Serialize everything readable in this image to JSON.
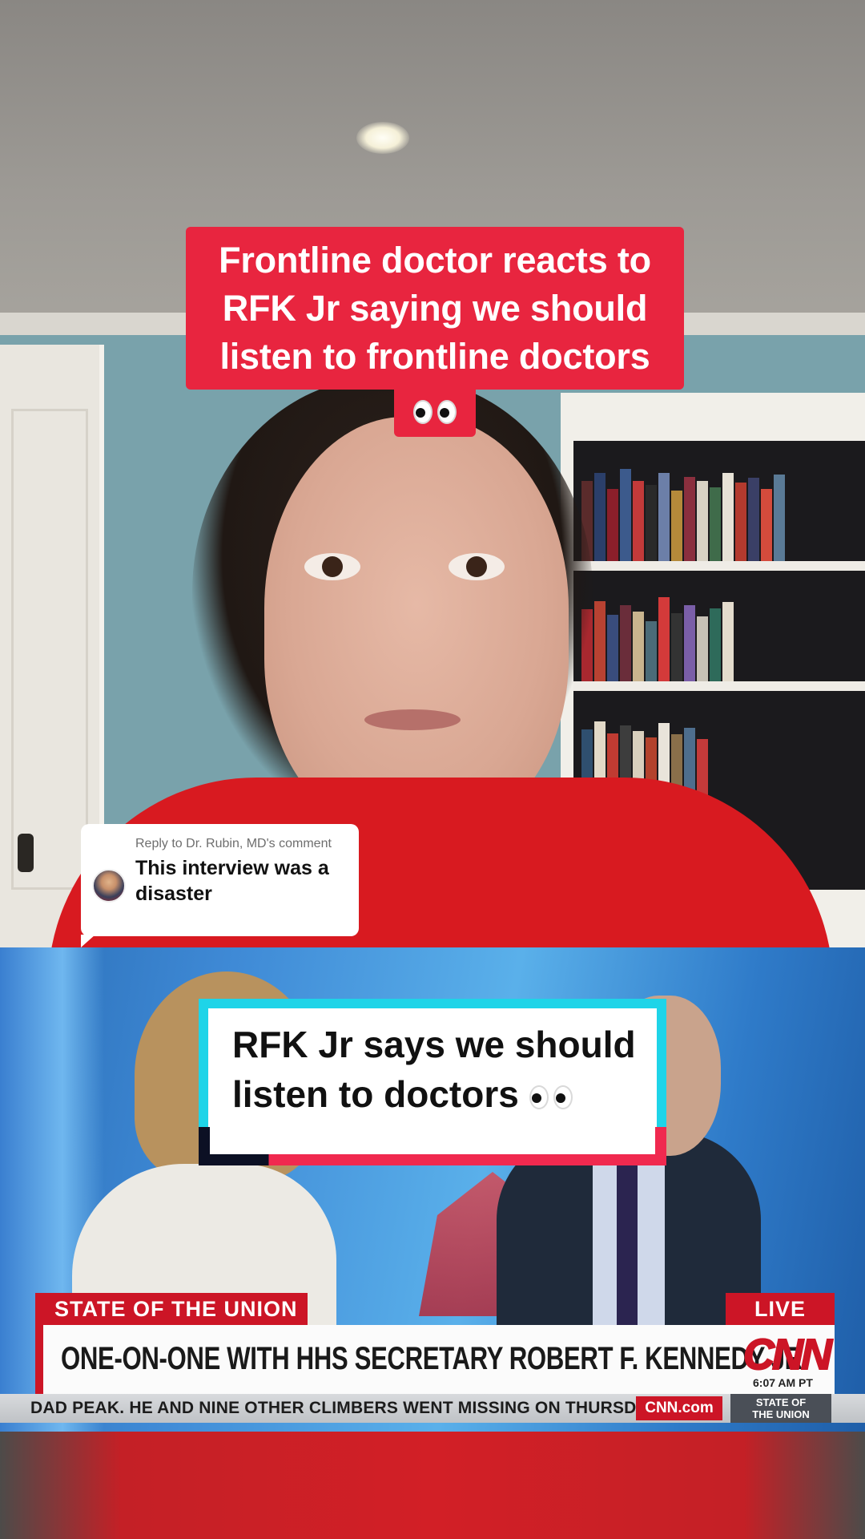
{
  "overlay": {
    "title_lines": [
      "Frontline doctor reacts to",
      "RFK Jr saying we should",
      "listen to frontline doctors"
    ],
    "title_emoji": "eyes-emoji"
  },
  "reply": {
    "label": "Reply to Dr. Rubin, MD's comment",
    "text": "This interview was a disaster"
  },
  "clip_caption": {
    "line1": "RFK Jr says we should",
    "line2": "listen to doctors",
    "emoji": "eyes-emoji"
  },
  "broadcast": {
    "show_tag": "STATE OF THE UNION",
    "live_tag": "LIVE",
    "headline": "ONE-ON-ONE WITH HHS SECRETARY ROBERT F. KENNEDY JR.",
    "network_logo": "CNN",
    "time": "6:07 AM PT",
    "ticker": "DAD PEAK. HE AND NINE OTHER CLIMBERS WENT MISSING ON THURSDAY.",
    "ticker_site": "CNN.com",
    "ticker_show": "STATE OF\nTHE UNION"
  },
  "colors": {
    "banner_red": "#e8253f",
    "caption_cyan": "#1ed4e8",
    "caption_pink": "#f0294f",
    "cnn_red": "#cc1526"
  }
}
